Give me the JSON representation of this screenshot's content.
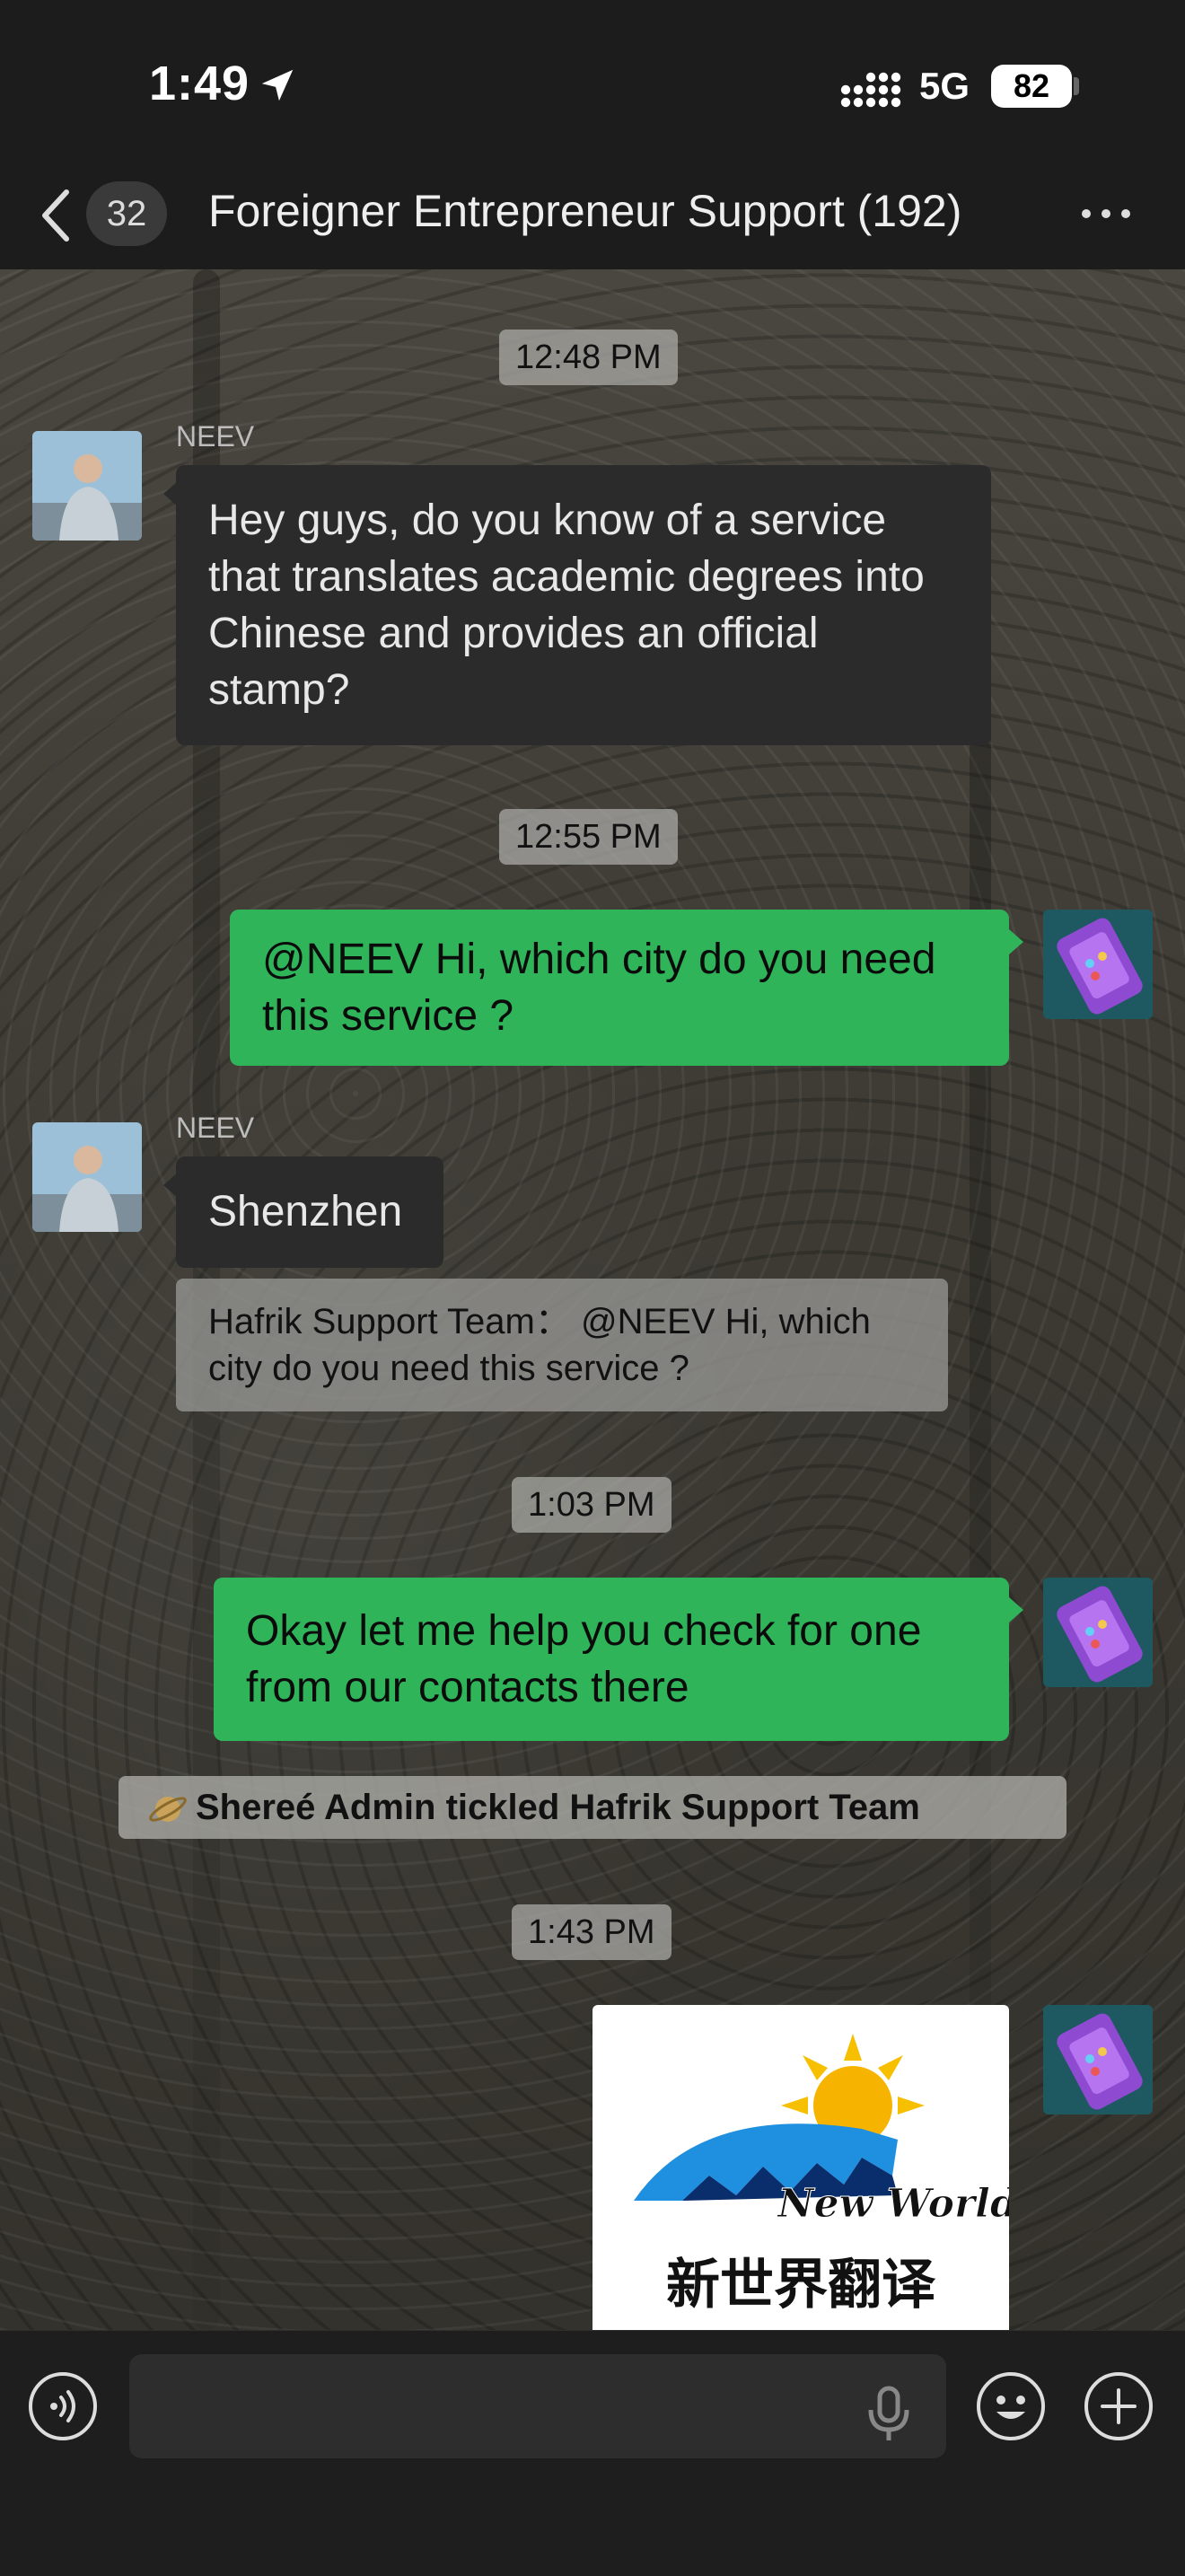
{
  "status_bar": {
    "time": "1:49",
    "network": "5G",
    "battery": "82"
  },
  "nav": {
    "unread_count": "32",
    "title": "Foreigner Entrepreneur Support (192)"
  },
  "messages": {
    "ts1": "12:48 PM",
    "m1": {
      "sender": "NEEV",
      "text": "Hey guys, do you know of a service that translates academic degrees into Chinese and provides an official stamp?"
    },
    "ts2": "12:55 PM",
    "m2": {
      "text": "@NEEV Hi, which city do you need this service ?"
    },
    "m3": {
      "sender": "NEEV",
      "text": "Shenzhen",
      "quote": "Hafrik Support Team： @NEEV Hi, which city do you need this service ?"
    },
    "ts3": "1:03 PM",
    "m4": {
      "text": "Okay let me help you check for one from our contacts there"
    },
    "system": "Shereé Admin tickled Hafrik Support Team",
    "ts4": "1:43 PM",
    "m5": {
      "logo_text": "New World",
      "caption": "新世界翻译"
    }
  },
  "input": {
    "placeholder": ""
  },
  "colors": {
    "outgoing_bubble": "#2fb45a",
    "incoming_bubble": "#2b2b2b",
    "background": "#1c1c1c"
  },
  "icons": [
    "location-arrow-icon",
    "signal-icon",
    "back-chevron-icon",
    "more-dots-icon",
    "voice-icon",
    "mic-icon",
    "emoji-icon",
    "plus-icon"
  ]
}
